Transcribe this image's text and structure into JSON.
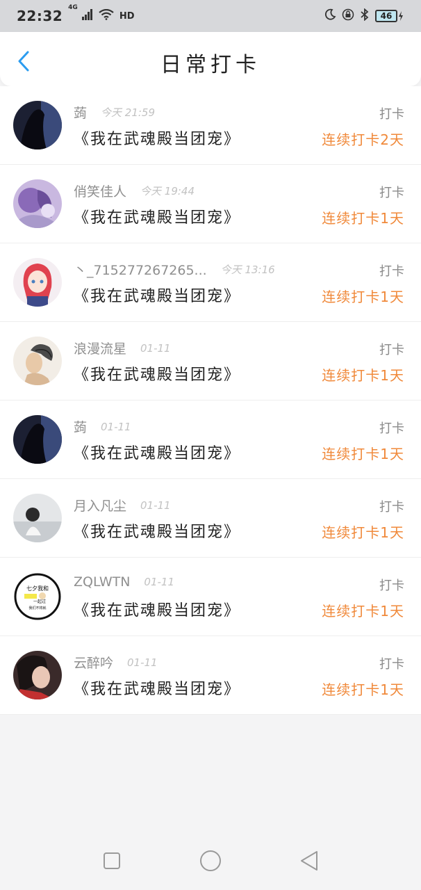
{
  "status": {
    "time": "22:32",
    "network": "4G",
    "hd": "HD",
    "battery": "46"
  },
  "header": {
    "title": "日常打卡"
  },
  "colors": {
    "accent_back": "#2b9cf0",
    "streak": "#f0893a"
  },
  "rows": [
    {
      "name": "蒟",
      "time": "今天 21:59",
      "checkin": "打卡",
      "book": "《我在武魂殿当团宠》",
      "streak": "连续打卡2天",
      "avatar": "dark-silhouette"
    },
    {
      "name": "俏笑佳人",
      "time": "今天 19:44",
      "checkin": "打卡",
      "book": "《我在武魂殿当团宠》",
      "streak": "连续打卡1天",
      "avatar": "purple-illustration"
    },
    {
      "name": "丶_715277267265...",
      "time": "今天 13:16",
      "checkin": "打卡",
      "book": "《我在武魂殿当团宠》",
      "streak": "连续打卡1天",
      "avatar": "anime-girl"
    },
    {
      "name": "浪漫流星",
      "time": "01-11",
      "checkin": "打卡",
      "book": "《我在武魂殿当团宠》",
      "streak": "连续打卡1天",
      "avatar": "sketch-woman"
    },
    {
      "name": "蒟",
      "time": "01-11",
      "checkin": "打卡",
      "book": "《我在武魂殿当团宠》",
      "streak": "连续打卡1天",
      "avatar": "dark-silhouette"
    },
    {
      "name": "月入凡尘",
      "time": "01-11",
      "checkin": "打卡",
      "book": "《我在武魂殿当团宠》",
      "streak": "连续打卡1天",
      "avatar": "beach-photo"
    },
    {
      "name": "ZQLWTN",
      "time": "01-11",
      "checkin": "打卡",
      "book": "《我在武魂殿当团宠》",
      "streak": "连续打卡1天",
      "avatar": "text-badge",
      "avatar_text": [
        "七夕我和",
        "一起过",
        "我们不将就"
      ]
    },
    {
      "name": "云醉吟",
      "time": "01-11",
      "checkin": "打卡",
      "book": "《我在武魂殿当团宠》",
      "streak": "连续打卡1天",
      "avatar": "portrait-photo"
    }
  ]
}
